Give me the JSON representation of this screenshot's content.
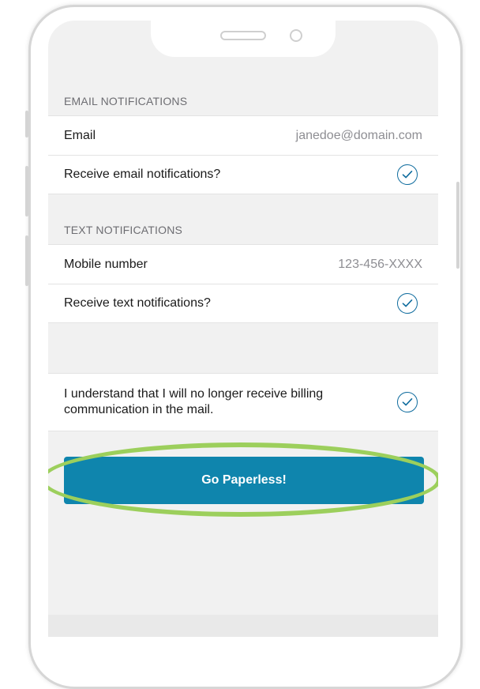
{
  "email_section": {
    "header": "EMAIL NOTIFICATIONS",
    "email_label": "Email",
    "email_value": "janedoe@domain.com",
    "receive_email_label": "Receive email notifications?"
  },
  "text_section": {
    "header": "TEXT NOTIFICATIONS",
    "mobile_label": "Mobile number",
    "mobile_value": "123-456-XXXX",
    "receive_text_label": "Receive text notifications?"
  },
  "agreement": {
    "label": "I understand that I will no longer receive billing communication in the mail."
  },
  "cta": {
    "label": "Go Paperless!"
  },
  "icons": {
    "check": "check-circle-icon"
  },
  "colors": {
    "accent": "#0f85ad",
    "check": "#0f6c9e",
    "highlight": "#9ccf5c",
    "background": "#f1f1f1"
  }
}
